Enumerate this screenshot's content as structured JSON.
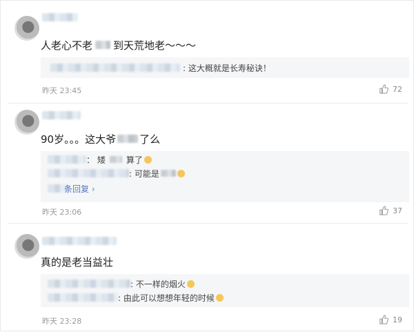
{
  "comments": [
    {
      "text_a": "人老心不老",
      "text_b": "到天荒地老～～～",
      "replies": [
        {
          "text": ": 这大概就是长寿秘诀！"
        }
      ],
      "time": "昨天 23:45",
      "likes": "72",
      "icons": {
        "like": "thumbs-up-icon"
      }
    },
    {
      "text_a": "90岁。。。这大爷",
      "text_b": "了么",
      "replies": [
        {
          "text_a": "： 矮",
          "text_b": "算了"
        },
        {
          "text": ": 可能是"
        }
      ],
      "more": "条回复",
      "time": "昨天 23:06",
      "likes": "37",
      "icons": {
        "like": "thumbs-up-icon"
      }
    },
    {
      "text": "真的是老当益壮",
      "replies": [
        {
          "text": ": 不一样的烟火"
        },
        {
          "text": ": 由此可以想想年轻的时候"
        }
      ],
      "time": "昨天 23:28",
      "likes": "19",
      "icons": {
        "like": "thumbs-up-icon"
      }
    }
  ],
  "colors": {
    "background": "#ffffff",
    "reply_bg": "#f5f6f7",
    "time": "#999999",
    "link": "#5a7dbd"
  }
}
